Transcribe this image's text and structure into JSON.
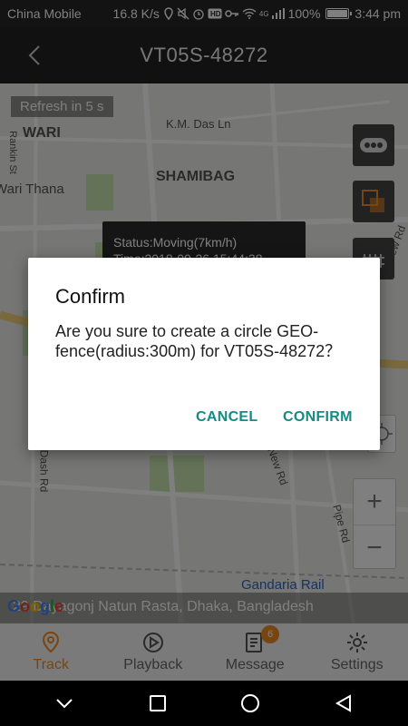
{
  "status_bar": {
    "carrier": "China Mobile",
    "speed": "16.8 K/s",
    "network": "4G",
    "battery": "100%",
    "battery_level": 1.0,
    "time": "3:44 pm"
  },
  "header": {
    "title": "VT05S-48272"
  },
  "map": {
    "refresh_text": "Refresh in 5 s",
    "labels": [
      "WARI",
      "K.M. Das Ln",
      "SHAMIBAG",
      "Rankin St",
      "Wari Thana",
      "New Rd",
      "Dash Rd",
      "New Rd",
      "Pipe Rd",
      "Gandaria Rail"
    ],
    "popup_line1": "Status:Moving(7km/h)",
    "popup_line2": "Time:2018-09-26 15:44:38",
    "address": "29 Dayagonj Natun Rasta, Dhaka, Bangladesh",
    "google_logo": "Google",
    "zoom_in": "+",
    "zoom_out": "−"
  },
  "dialog": {
    "title": "Confirm",
    "message": "Are you sure to create a circle GEO-fence(radius:300m) for VT05S-48272？",
    "cancel_label": "CANCEL",
    "confirm_label": "CONFIRM"
  },
  "tabs": [
    {
      "label": "Track",
      "icon": "location-pin-icon",
      "active": true
    },
    {
      "label": "Playback",
      "icon": "play-circle-icon",
      "active": false
    },
    {
      "label": "Message",
      "icon": "message-icon",
      "active": false,
      "badge": "6"
    },
    {
      "label": "Settings",
      "icon": "gear-icon",
      "active": false
    }
  ],
  "colors": {
    "accent": "#f08a22",
    "dialog_button": "#168a84",
    "header_bg": "#222222"
  }
}
